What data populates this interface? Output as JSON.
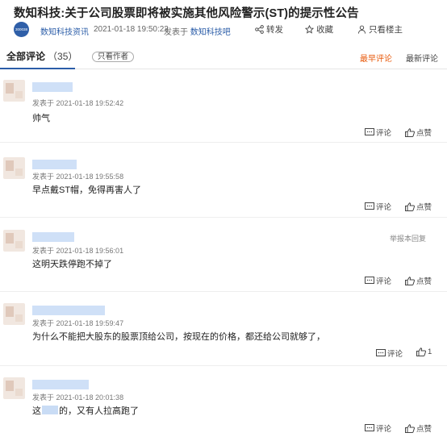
{
  "article": {
    "title": "数知科技:关于公司股票即将被实施其他风险警示(ST)的提示性公告",
    "logo_text": "300038",
    "author": "数知科技资讯",
    "time": "2021-01-18 19:50:22",
    "from_label": "发表于",
    "source": "数知科技吧",
    "share_label": "转发",
    "fav_label": "收藏",
    "host_label": "只看楼主"
  },
  "tabs": {
    "all_label": "全部评论",
    "count": "（35）",
    "only_author": "只看作者",
    "sort_early": "最早评论",
    "sort_new": "最新评论"
  },
  "comments": [
    {
      "time": "发表于 2021-01-18 19:52:42",
      "text": "帅气",
      "reply": "评论",
      "like": "点赞",
      "report": ""
    },
    {
      "time": "发表于 2021-01-18 19:55:58",
      "text": "早点戴ST帽，免得再害人了",
      "reply": "评论",
      "like": "点赞",
      "report": ""
    },
    {
      "time": "发表于 2021-01-18 19:56:01",
      "text": "这明天跌停跑不掉了",
      "reply": "评论",
      "like": "点赞",
      "report": "举报本回复"
    },
    {
      "time": "发表于 2021-01-18 19:59:47",
      "text": "为什么不能把大股东的股票顶给公司，按现在的价格，都还给公司就够了，",
      "reply": "评论",
      "like": "1",
      "report": ""
    },
    {
      "time": "发表于 2021-01-18 20:01:38",
      "text_a": "这",
      "text_b": "的，又有人拉高跑了",
      "reply": "评论",
      "like": "点赞",
      "report": ""
    }
  ],
  "colors": {
    "accent": "#2b5da8",
    "sort_active": "#e85a0c"
  },
  "icons": {
    "share": "share-icon",
    "fav": "star-icon",
    "host": "person-icon",
    "reply": "comment-icon",
    "like": "thumbs-up-icon"
  }
}
